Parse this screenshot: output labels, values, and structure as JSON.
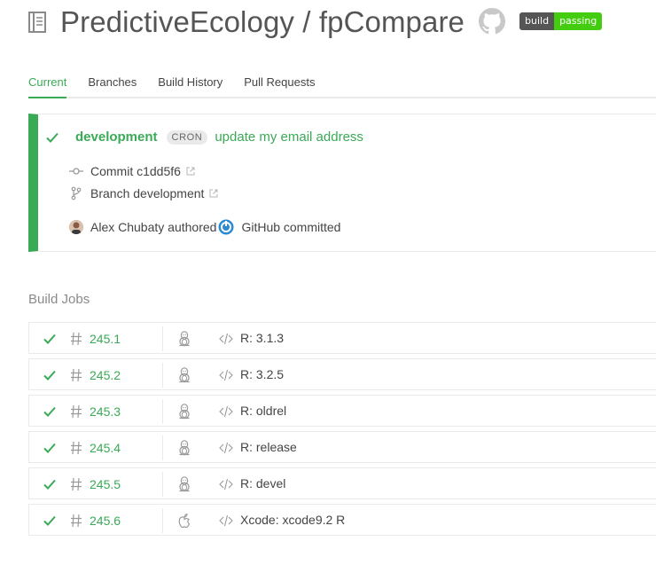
{
  "header": {
    "owner": "PredictiveEcology",
    "separator": "/",
    "repo": "fpCompare",
    "badge": {
      "left": "build",
      "right": "passing",
      "color": "#44cc11"
    }
  },
  "tabs": [
    {
      "label": "Current",
      "active": true
    },
    {
      "label": "Branches",
      "active": false
    },
    {
      "label": "Build History",
      "active": false
    },
    {
      "label": "Pull Requests",
      "active": false
    }
  ],
  "build": {
    "status": "passed",
    "status_color": "#39aa56",
    "branch": "development",
    "event_badge": "CRON",
    "message": "update my email address",
    "commit_label": "Commit c1dd5f6",
    "branch_label": "Branch development",
    "author": "Alex Chubaty authored",
    "committer": "GitHub committed"
  },
  "jobs_title": "Build Jobs",
  "jobs": [
    {
      "number": "245.1",
      "os": "linux-icon",
      "env": "R: 3.1.3"
    },
    {
      "number": "245.2",
      "os": "linux-icon",
      "env": "R: 3.2.5"
    },
    {
      "number": "245.3",
      "os": "linux-icon",
      "env": "R: oldrel"
    },
    {
      "number": "245.4",
      "os": "linux-icon",
      "env": "R: release"
    },
    {
      "number": "245.5",
      "os": "linux-icon",
      "env": "R: devel"
    },
    {
      "number": "245.6",
      "os": "apple-icon",
      "env": "Xcode: xcode9.2 R"
    }
  ]
}
